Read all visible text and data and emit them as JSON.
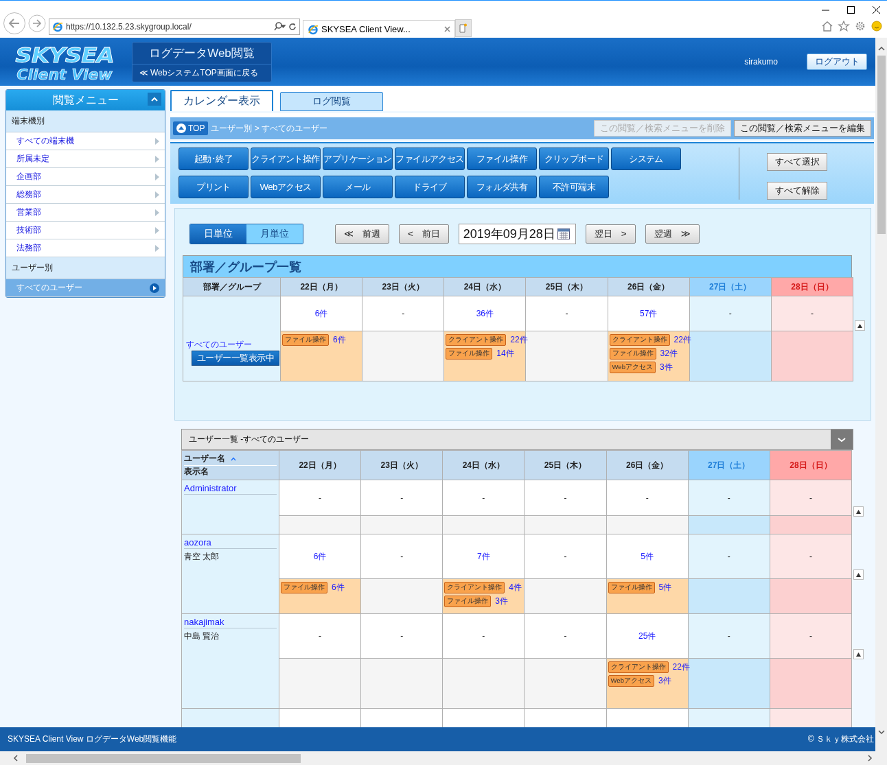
{
  "browser": {
    "address": "https://10.132.5.23.skygroup.local/",
    "tab": "SKYSEA Client View..."
  },
  "header": {
    "logo": [
      "SKYSEA",
      "Client View"
    ],
    "app_title": "ログデータWeb閲覧",
    "back_link": "≪ WebシステムTOP画面に戻る",
    "user": "sirakumo",
    "logout": "ログアウト"
  },
  "sidebar": {
    "title": "閲覧メニュー",
    "sections": [
      {
        "label": "端末機別",
        "items": [
          {
            "label": "すべての端末機",
            "selected": false
          },
          {
            "label": "所属未定",
            "selected": false
          },
          {
            "label": "企画部",
            "selected": false
          },
          {
            "label": "総務部",
            "selected": false
          },
          {
            "label": "営業部",
            "selected": false
          },
          {
            "label": "技術部",
            "selected": false
          },
          {
            "label": "法務部",
            "selected": false
          }
        ]
      },
      {
        "label": "ユーザー別",
        "items": [
          {
            "label": "すべてのユーザー",
            "selected": true
          }
        ]
      }
    ]
  },
  "tabs": [
    {
      "label": "カレンダー表示",
      "selected": true
    },
    {
      "label": "ログ閲覧",
      "selected": false
    }
  ],
  "breadcrumb": {
    "top": "TOP",
    "path": "ユーザー別 > すべてのユーザー",
    "actions": [
      {
        "label": "この閲覧／検索メニューを削除",
        "disabled": true
      },
      {
        "label": "この閲覧／検索メニューを編集",
        "disabled": false
      }
    ]
  },
  "categories": [
    [
      "起動･終了",
      "クライアント操作",
      "アプリケーション",
      "ファイルアクセス",
      "ファイル操作",
      "クリップボード",
      "システム"
    ],
    [
      "プリント",
      "Webアクセス",
      "メール",
      "ドライブ",
      "フォルダ共有",
      "不許可端末"
    ]
  ],
  "select_buttons": [
    "すべて選択",
    "すべて解除"
  ],
  "view_toggle": [
    {
      "label": "日単位",
      "selected": true
    },
    {
      "label": "月単位",
      "selected": false
    }
  ],
  "date_nav": {
    "back": [
      "≪　前週",
      "<　前日"
    ],
    "date": "2019年09月28日",
    "forward": [
      "翌日　>",
      "翌週　≫"
    ]
  },
  "group_table": {
    "title": "部署／グループ一覧",
    "first_column": "部署／グループ",
    "columns": [
      {
        "label": "22日（月）",
        "kind": "weekday"
      },
      {
        "label": "23日（火）",
        "kind": "weekday"
      },
      {
        "label": "24日（水）",
        "kind": "weekday"
      },
      {
        "label": "25日（木）",
        "kind": "weekday"
      },
      {
        "label": "26日（金）",
        "kind": "weekday"
      },
      {
        "label": "27日（土）",
        "kind": "saturday"
      },
      {
        "label": "28日（日）",
        "kind": "sunday"
      }
    ],
    "rows": [
      {
        "name": "すべてのユーザー",
        "button": "ユーザー一覧表示中",
        "totals": [
          "6件",
          "-",
          "36件",
          "-",
          "57件",
          "-",
          "-"
        ],
        "details": [
          {
            "kind": "activity",
            "items": [
              {
                "tag": "ファイル操作",
                "count": "6件"
              }
            ]
          },
          {
            "kind": "empty"
          },
          {
            "kind": "activity",
            "items": [
              {
                "tag": "クライアント操作",
                "count": "22件"
              },
              {
                "tag": "ファイル操作",
                "count": "14件"
              }
            ]
          },
          {
            "kind": "empty"
          },
          {
            "kind": "activity",
            "items": [
              {
                "tag": "クライアント操作",
                "count": "22件"
              },
              {
                "tag": "ファイル操作",
                "count": "32件"
              },
              {
                "tag": "Webアクセス",
                "count": "3件"
              }
            ]
          },
          {
            "kind": "empty"
          },
          {
            "kind": "empty"
          }
        ]
      }
    ]
  },
  "user_table": {
    "title": "ユーザー一覧 -すべてのユーザー",
    "first_column": [
      "ユーザー名",
      "表示名"
    ],
    "columns": [
      {
        "label": "22日（月）",
        "kind": "weekday"
      },
      {
        "label": "23日（火）",
        "kind": "weekday"
      },
      {
        "label": "24日（水）",
        "kind": "weekday"
      },
      {
        "label": "25日（木）",
        "kind": "weekday"
      },
      {
        "label": "26日（金）",
        "kind": "weekday"
      },
      {
        "label": "27日（土）",
        "kind": "saturday"
      },
      {
        "label": "28日（日）",
        "kind": "sunday"
      }
    ],
    "rows": [
      {
        "kind": "user",
        "user": "Administrator",
        "totals": [
          "-",
          "-",
          "-",
          "-",
          "-",
          "-",
          "-"
        ],
        "details": [
          {
            "kind": "empty"
          },
          {
            "kind": "empty"
          },
          {
            "kind": "empty"
          },
          {
            "kind": "empty"
          },
          {
            "kind": "empty"
          },
          {
            "kind": "empty"
          },
          {
            "kind": "empty"
          }
        ]
      },
      {
        "kind": "user",
        "user": "aozora",
        "display": "青空 太郎",
        "totals": [
          "6件",
          "-",
          "7件",
          "-",
          "5件",
          "-",
          "-"
        ],
        "details": [
          {
            "kind": "activity",
            "items": [
              {
                "tag": "ファイル操作",
                "count": "6件"
              }
            ]
          },
          {
            "kind": "empty"
          },
          {
            "kind": "activity",
            "items": [
              {
                "tag": "クライアント操作",
                "count": "4件"
              },
              {
                "tag": "ファイル操作",
                "count": "3件"
              }
            ]
          },
          {
            "kind": "empty"
          },
          {
            "kind": "activity",
            "items": [
              {
                "tag": "ファイル操作",
                "count": "5件"
              }
            ]
          },
          {
            "kind": "empty"
          },
          {
            "kind": "empty"
          }
        ]
      },
      {
        "kind": "user",
        "user": "nakajimak",
        "display": "中島 賢治",
        "totals": [
          "-",
          "-",
          "-",
          "-",
          "25件",
          "-",
          "-"
        ],
        "details": [
          {
            "kind": "empty"
          },
          {
            "kind": "empty"
          },
          {
            "kind": "empty"
          },
          {
            "kind": "empty"
          },
          {
            "kind": "activity",
            "items": [
              {
                "tag": "クライアント操作",
                "count": "22件"
              },
              {
                "tag": "Webアクセス",
                "count": "3件"
              }
            ]
          },
          {
            "kind": "empty"
          },
          {
            "kind": "empty"
          }
        ]
      },
      {
        "kind": "blank"
      }
    ]
  },
  "footer": {
    "product": "SKYSEA Client View ログデータWeb閲覧機能",
    "copyright": "© Ｓｋｙ株式会社"
  }
}
